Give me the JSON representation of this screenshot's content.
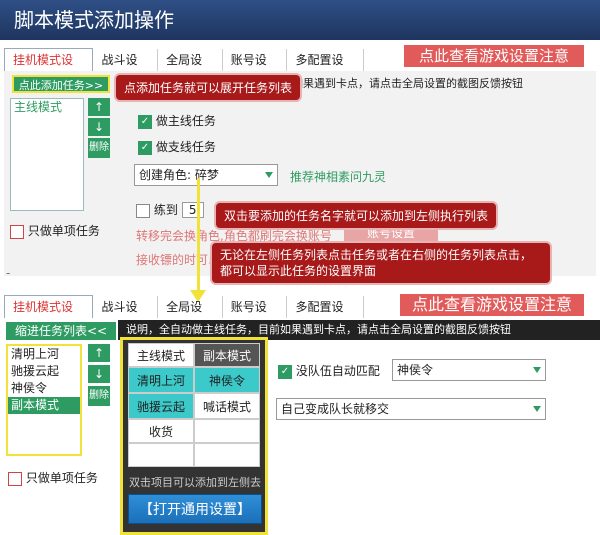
{
  "window": {
    "title": "脚本模式添加操作"
  },
  "top": {
    "tabs": [
      "挂机模式设置",
      "战斗设置",
      "全局设置",
      "账号设置",
      "多配置设置"
    ],
    "red_button": "点此查看游戏设置注意",
    "add_task_button": "点此添加任务>>",
    "partial_notice": "如果遇到卡点，请点击全局设置的截图反馈按钮",
    "task_list": [
      "主线模式"
    ],
    "delete_label": "删除",
    "do_main": "做主线任务",
    "do_side": "做支线任务",
    "create_role_prefix": "创建角色:",
    "create_role_value": "碎梦",
    "recommend": "推荐神相素问九灵",
    "train_to_label": "练到",
    "train_to_value": "5",
    "transfer_text": "转移完会换角色,角色都刷完会换账号",
    "account_settings": "账号设置",
    "receive_text": "接收镖的时可以",
    "only_single": "只做单项任务",
    "bottom_dash": "-"
  },
  "callouts": {
    "c1": "点添加任务就可以展开任务列表",
    "c2": "双击要添加的任务名字就可以添加到左侧执行列表",
    "c3": "无论在左侧任务列表点击任务或者在右侧的任务列表点击，都可以显示此任务的设置界面"
  },
  "bottom": {
    "tabs": [
      "挂机模式设置",
      "战斗设置",
      "全局设置",
      "账号设置",
      "多配置设置"
    ],
    "red_button": "点此查看游戏设置注意",
    "collapse_button": "缩进任务列表<<",
    "notice": "说明，全自动做主线任务，目前如果遇到卡点，请点击全局设置的截图反馈按钮",
    "task_list": [
      "清明上河",
      "驰援云起",
      "神侯令",
      "副本模式"
    ],
    "delete_label": "删除",
    "grid": [
      [
        "主线模式",
        "副本模式"
      ],
      [
        "清明上河",
        "神侯令"
      ],
      [
        "驰援云起",
        "喊话模式"
      ],
      [
        "收货",
        ""
      ],
      [
        "",
        ""
      ]
    ],
    "hint": "双击项目可以添加到左侧去",
    "open_settings": "【打开通用设置】",
    "auto_match_label": "没队伍自动匹配",
    "auto_match_value": "神侯令",
    "transfer_select": "自己变成队长就移交",
    "only_single": "只做单项任务"
  }
}
